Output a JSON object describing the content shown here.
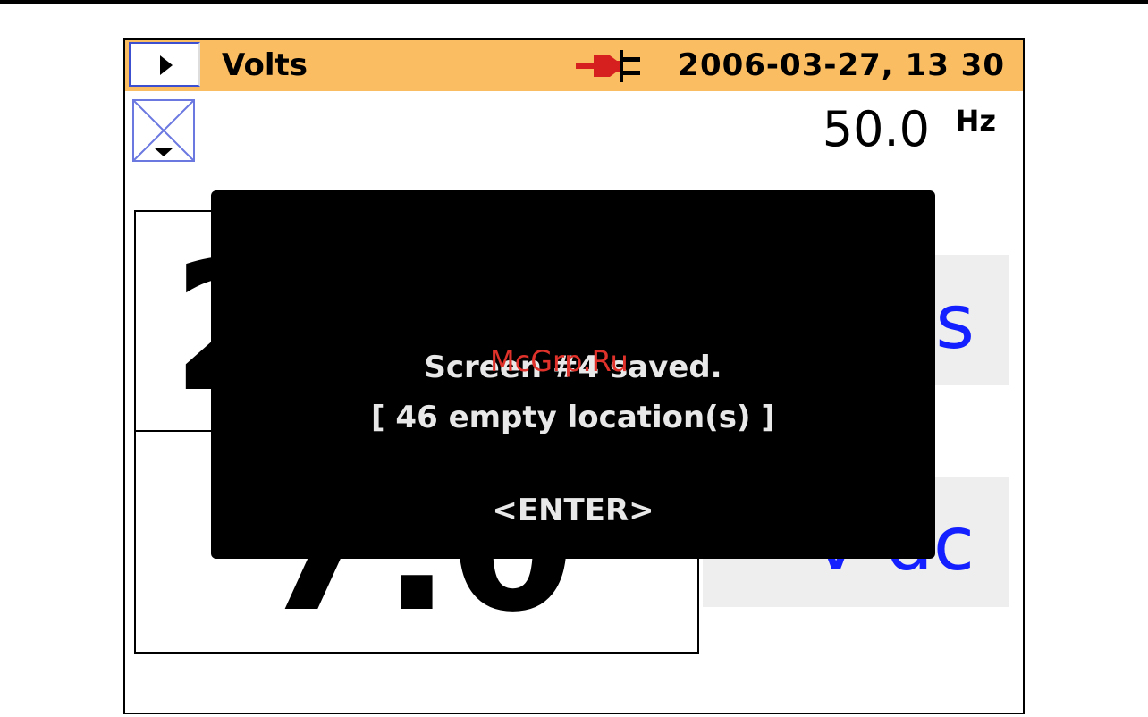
{
  "header": {
    "title": "Volts",
    "datetime": "2006-03-27, 13 30"
  },
  "frequency": {
    "value": "50.0",
    "unit": "Hz"
  },
  "readings": [
    {
      "value": "2",
      "unit": "s"
    },
    {
      "value": "7.0",
      "unit": "V dc"
    }
  ],
  "dialog": {
    "line1": "Screen #4 saved.",
    "line2": "[ 46 empty location(s) ]",
    "action": "<ENTER>"
  },
  "watermark": "McGrp.Ru",
  "colors": {
    "titlebar": "#fbbd62",
    "unit_text": "#1420ff",
    "dialog_bg": "#000000",
    "watermark": "#e0322a"
  },
  "icons": {
    "play": "play-icon",
    "plug": "plug-icon",
    "scope": "scope-icon"
  }
}
